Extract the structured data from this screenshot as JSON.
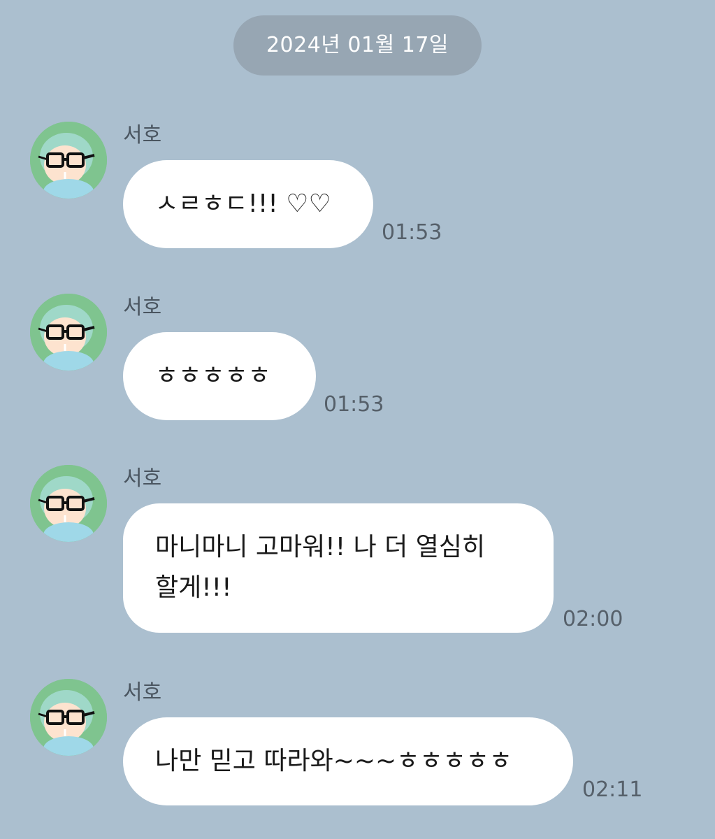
{
  "date_label": "2024년 01월 17일",
  "messages": [
    {
      "sender": "서호",
      "text": "ㅅㄹㅎㄷ!!! ♡♡",
      "time": "01:53"
    },
    {
      "sender": "서호",
      "text": "ㅎㅎㅎㅎㅎ",
      "time": "01:53"
    },
    {
      "sender": "서호",
      "text_lines": [
        "마니마니 고마워!! 나 더 열심히",
        "할게!!!"
      ],
      "time": "02:00"
    },
    {
      "sender": "서호",
      "text": "나만 믿고 따라와~~~ㅎㅎㅎㅎㅎ",
      "time": "02:11"
    }
  ],
  "colors": {
    "background": "#abbfcf",
    "date_pill": "#97a6b3",
    "bubble": "#ffffff"
  }
}
